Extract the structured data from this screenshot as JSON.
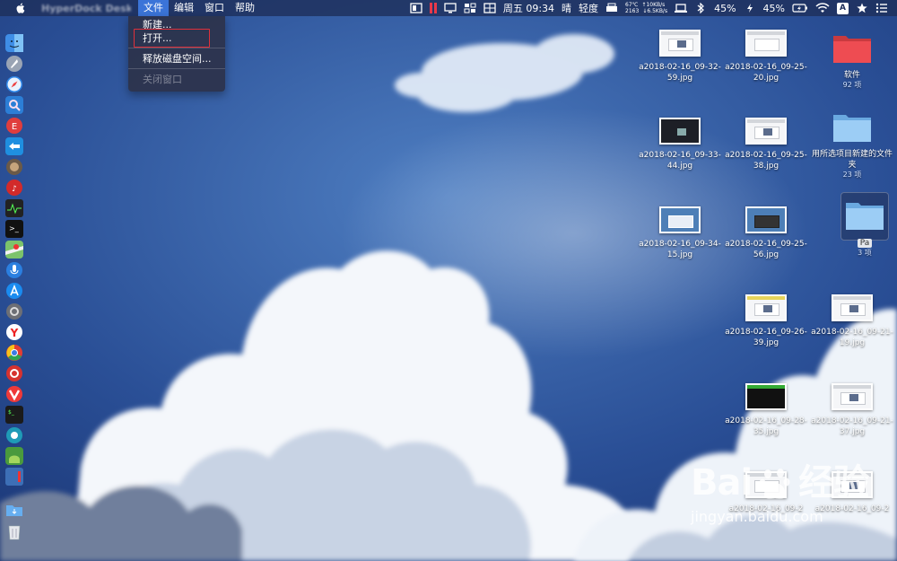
{
  "menubar": {
    "app_name": "HyperDock Desktop",
    "menus": [
      "文件",
      "编辑",
      "窗口",
      "帮助"
    ],
    "status": {
      "datetime": "周五 09:34",
      "weather": "晴",
      "air": "轻度",
      "temp": "67℃",
      "net_up": "↑10KB/s",
      "rpm": "2163",
      "net_down": "↓6.5KB/s",
      "battery1": "45%",
      "battery2": "45%",
      "ime": "A"
    }
  },
  "file_menu": {
    "items": [
      {
        "label": "新建...",
        "enabled": true
      },
      {
        "label": "打开...",
        "enabled": true,
        "highlighted": true
      },
      {
        "label": "释放磁盘空间...",
        "enabled": true
      },
      {
        "label": "关闭窗口",
        "enabled": false
      }
    ]
  },
  "dock": {
    "apps": [
      "finder",
      "launchpad",
      "safari",
      "preview",
      "app-store-red",
      "teamviewer",
      "photos",
      "netease-music",
      "activity-monitor",
      "terminal",
      "maps",
      "siri",
      "app-store",
      "system-preferences",
      "yandex",
      "chrome",
      "netease-cloud",
      "vivaldi",
      "iterm",
      "edge",
      "android-studio",
      "shell",
      "downloads",
      "trash"
    ]
  },
  "desktop": {
    "files": [
      {
        "name": "a2018-02-16_09-32-59.jpg"
      },
      {
        "name": "a2018-02-16_09-25-20.jpg"
      },
      {
        "name": "a2018-02-16_09-33-44.jpg"
      },
      {
        "name": "a2018-02-16_09-25-38.jpg"
      },
      {
        "name": "a2018-02-16_09-34-15.jpg"
      },
      {
        "name": "a2018-02-16_09-25-56.jpg"
      },
      {
        "name": "a2018-02-16_09-26-39.jpg"
      },
      {
        "name": "a2018-02-16_09-21-19.jpg"
      },
      {
        "name": "a2018-02-16_09-28-35.jpg"
      },
      {
        "name": "a2018-02-16_09-21-37.jpg"
      },
      {
        "name": "a2018-02-16_09-2"
      },
      {
        "name": "a2018-02-16_09-2"
      }
    ],
    "folders": [
      {
        "name": "软件",
        "count": "92 项",
        "color": "#e8474d"
      },
      {
        "name": "用所选项目新建的文件夹",
        "count": "23 项",
        "color": "#8cc4f1"
      },
      {
        "name": "Pa",
        "count": "3 项",
        "color": "#8cc4f1"
      }
    ]
  },
  "watermark": {
    "brand": "Bai",
    "brand2": "经验",
    "url": "jingyan.baidu.com"
  }
}
